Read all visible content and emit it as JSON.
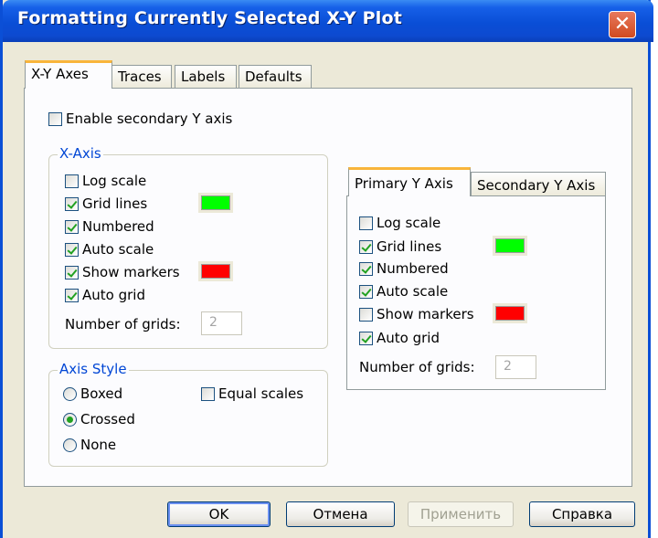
{
  "window": {
    "title": "Formatting Currently Selected X-Y Plot",
    "close_icon": "✕"
  },
  "tabs": [
    {
      "label": "X-Y Axes",
      "active": true
    },
    {
      "label": "Traces",
      "active": false
    },
    {
      "label": "Labels",
      "active": false
    },
    {
      "label": "Defaults",
      "active": false
    }
  ],
  "enable_secondary_y": {
    "label": "Enable secondary Y axis",
    "checked": false
  },
  "x_axis": {
    "title": "X-Axis",
    "log_scale": "Log scale",
    "grid_lines": "Grid lines",
    "numbered": "Numbered",
    "auto_scale": "Auto scale",
    "show_markers": "Show markers",
    "auto_grid": "Auto grid",
    "num_grids_label": "Number of grids:",
    "num_grids_value": "2",
    "grid_color": "#00ff00",
    "marker_color": "#ff0000"
  },
  "y_tabs": {
    "primary": "Primary Y Axis",
    "secondary": "Secondary Y Axis"
  },
  "y_axis": {
    "log_scale": "Log scale",
    "grid_lines": "Grid lines",
    "numbered": "Numbered",
    "auto_scale": "Auto scale",
    "show_markers": "Show markers",
    "auto_grid": "Auto grid",
    "num_grids_label": "Number of grids:",
    "num_grids_value": "2",
    "grid_color": "#00ff00",
    "marker_color": "#ff0000"
  },
  "axis_style": {
    "title": "Axis Style",
    "boxed": "Boxed",
    "crossed": "Crossed",
    "none": "None",
    "selected": "Crossed",
    "equal_scales": "Equal scales"
  },
  "buttons": {
    "ok": "OK",
    "cancel": "Отмена",
    "apply": "Применить",
    "help": "Справка"
  },
  "colors": {
    "title_bar": "#0a4ed6",
    "tab_highlight": "#f9b53b",
    "group_label": "#0046d5",
    "check": "#21a121"
  }
}
